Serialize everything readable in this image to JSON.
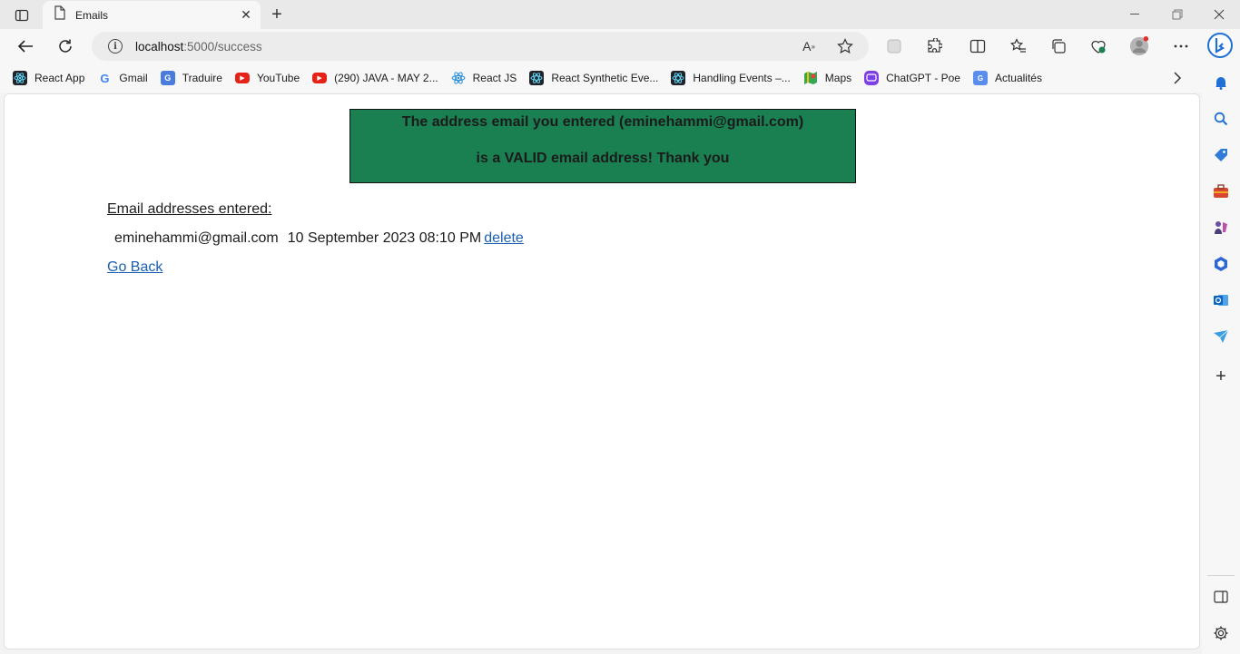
{
  "tab": {
    "title": "Emails"
  },
  "address_bar": {
    "host": "localhost",
    "path": ":5000/success"
  },
  "bookmarks": [
    {
      "label": "React App",
      "icon": "react-icon"
    },
    {
      "label": "Gmail",
      "icon": "google-icon"
    },
    {
      "label": "Traduire",
      "icon": "translate-icon"
    },
    {
      "label": "YouTube",
      "icon": "youtube-icon"
    },
    {
      "label": "(290) JAVA - MAY 2...",
      "icon": "youtube-icon"
    },
    {
      "label": "React JS",
      "icon": "react-icon"
    },
    {
      "label": "React Synthetic Eve...",
      "icon": "react-icon"
    },
    {
      "label": "Handling Events –...",
      "icon": "react-icon"
    },
    {
      "label": "Maps",
      "icon": "maps-icon"
    },
    {
      "label": "ChatGPT - Poe",
      "icon": "poe-icon"
    },
    {
      "label": "Actualités",
      "icon": "news-icon"
    }
  ],
  "page": {
    "banner_line1": "The address email you entered (eminehammi@gmail.com)",
    "banner_line2": "is a VALID email address! Thank you",
    "emails_title": "Email addresses entered:",
    "entries": [
      {
        "email": "eminehammi@gmail.com",
        "date": "10 September 2023 08:10 PM",
        "action": "delete"
      }
    ],
    "go_back": "Go Back"
  },
  "colors": {
    "banner": "#1a7f51",
    "link": "#1a5fb4"
  }
}
